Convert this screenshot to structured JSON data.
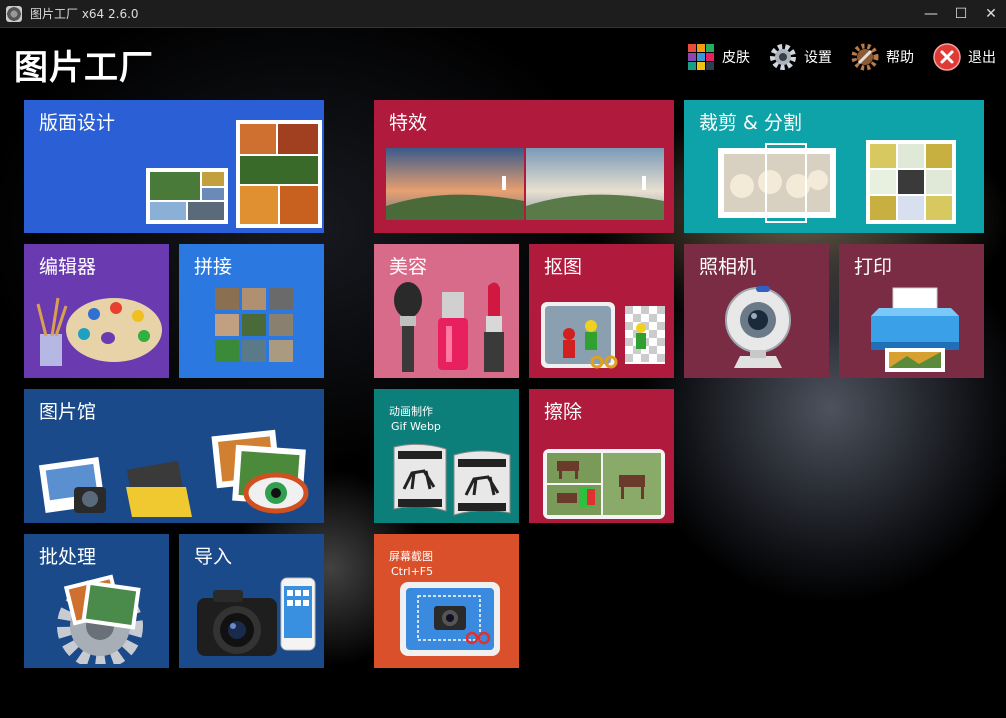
{
  "window": {
    "title": "图片工厂 x64 2.6.0",
    "minimize_glyph": "—",
    "maximize_glyph": "☐",
    "close_glyph": "✕"
  },
  "app": {
    "heading": "图片工厂"
  },
  "menu": {
    "skin": "皮肤",
    "settings": "设置",
    "help": "帮助",
    "exit": "退出"
  },
  "tiles": {
    "layout_design": "版面设计",
    "effects": "特效",
    "crop_split": "裁剪 & 分割",
    "editor": "编辑器",
    "collage": "拼接",
    "beauty": "美容",
    "cutout": "抠图",
    "camera": "照相机",
    "print": "打印",
    "gallery": "图片馆",
    "animation": "动画制作",
    "animation_formats": "Gif Webp",
    "erase": "擦除",
    "batch": "批处理",
    "import": "导入",
    "screenshot": "屏幕截图",
    "screenshot_shortcut": "Ctrl+F5"
  },
  "colors": {
    "blue": "#2a5fd6",
    "crimson": "#b01a3c",
    "teal": "#0ea3a8",
    "purple": "#6a3bb0",
    "rose": "#d86a8a",
    "maroon": "#7a2c44",
    "navy": "#1a4a8a",
    "dark_teal": "#0d7f7a",
    "orange": "#d9502a"
  }
}
